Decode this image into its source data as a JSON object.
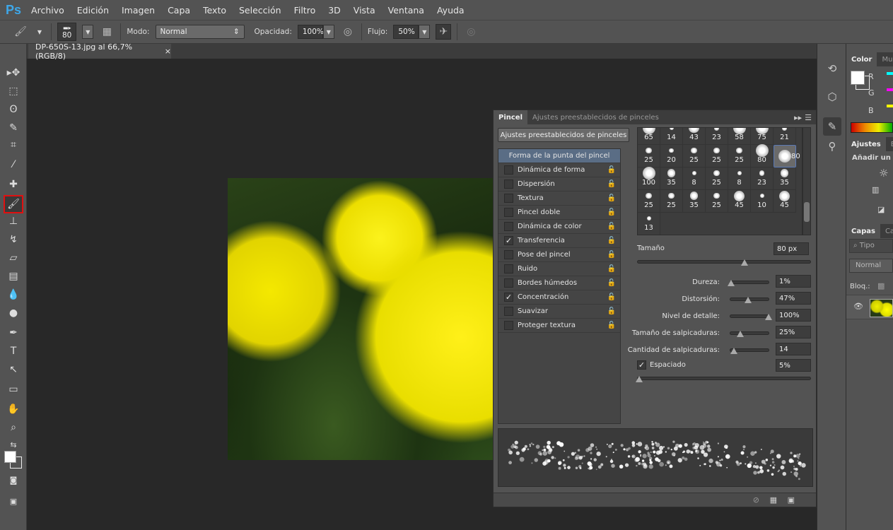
{
  "app": {
    "logo": "Ps"
  },
  "menu": [
    "Archivo",
    "Edición",
    "Imagen",
    "Capa",
    "Texto",
    "Selección",
    "Filtro",
    "3D",
    "Vista",
    "Ventana",
    "Ayuda"
  ],
  "options": {
    "brush_size": "80",
    "mode_label": "Modo:",
    "mode_value": "Normal",
    "opacity_label": "Opacidad:",
    "opacity_value": "100%",
    "flow_label": "Flujo:",
    "flow_value": "50%"
  },
  "document": {
    "tab_title": "DP-650S-13.jpg al 66,7% (RGB/8)",
    "close": "×"
  },
  "tools": [
    "move",
    "marquee",
    "lasso",
    "quick-selection",
    "crop",
    "eyedropper",
    "healing-brush",
    "brush",
    "clone-stamp",
    "history-brush",
    "eraser",
    "gradient",
    "blur",
    "dodge",
    "pen",
    "type",
    "path-selection",
    "rectangle",
    "hand",
    "zoom"
  ],
  "active_tool": "brush",
  "brush_panel": {
    "tabs": [
      "Pincel",
      "Ajustes preestablecidos de pinceles"
    ],
    "preset_button": "Ajustes preestablecidos de pinceles",
    "tip_shape_header": "Forma de la punta del pincel",
    "options": [
      {
        "label": "Dinámica de forma",
        "checked": false
      },
      {
        "label": "Dispersión",
        "checked": false
      },
      {
        "label": "Textura",
        "checked": false
      },
      {
        "label": "Pincel doble",
        "checked": false
      },
      {
        "label": "Dinámica de color",
        "checked": false
      },
      {
        "label": "Transferencia",
        "checked": true
      },
      {
        "label": "Pose del pincel",
        "checked": false
      },
      {
        "label": "Ruido",
        "checked": false
      },
      {
        "label": "Bordes húmedos",
        "checked": false
      },
      {
        "label": "Concentración",
        "checked": true
      },
      {
        "label": "Suavizar",
        "checked": false
      },
      {
        "label": "Proteger textura",
        "checked": false
      }
    ],
    "brush_sizes": [
      "65",
      "14",
      "43",
      "23",
      "58",
      "75",
      "21",
      "25",
      "20",
      "25",
      "25",
      "25",
      "80",
      "80",
      "100",
      "35",
      "8",
      "25",
      "8",
      "23",
      "35",
      "25",
      "25",
      "35",
      "25",
      "45",
      "10",
      "45",
      "13"
    ],
    "selected_brush_index": 13,
    "size_label": "Tamaño",
    "size_value": "80 px",
    "size_fraction": 0.62,
    "sliders": [
      {
        "label": "Dureza:",
        "value": "1%",
        "level": 0.01
      },
      {
        "label": "Distorsión:",
        "value": "47%",
        "level": 0.47
      },
      {
        "label": "Nivel de detalle:",
        "value": "100%",
        "level": 1.0
      },
      {
        "label": "Tamaño de salpicaduras:",
        "value": "25%",
        "level": 0.25
      },
      {
        "label": "Cantidad de salpicaduras:",
        "value": "14",
        "level": 0.1
      }
    ],
    "spacing_label": "Espaciado",
    "spacing_checked": true,
    "spacing_value": "5%",
    "spacing_level": 0.01
  },
  "right": {
    "color_tabs": [
      "Color",
      "Mue"
    ],
    "channels": [
      "R",
      "G",
      "B"
    ],
    "adjust_tabs": [
      "Ajustes",
      "Est"
    ],
    "adjust_title": "Añadir un aj",
    "layers_tabs": [
      "Capas",
      "Can"
    ],
    "filter_placeholder": "Tipo",
    "blend": "Normal",
    "lock_label": "Bloq.:"
  },
  "colors": {
    "accent_red": "#e01010",
    "selection_blue": "#5a7ab8",
    "panel": "#535353"
  }
}
